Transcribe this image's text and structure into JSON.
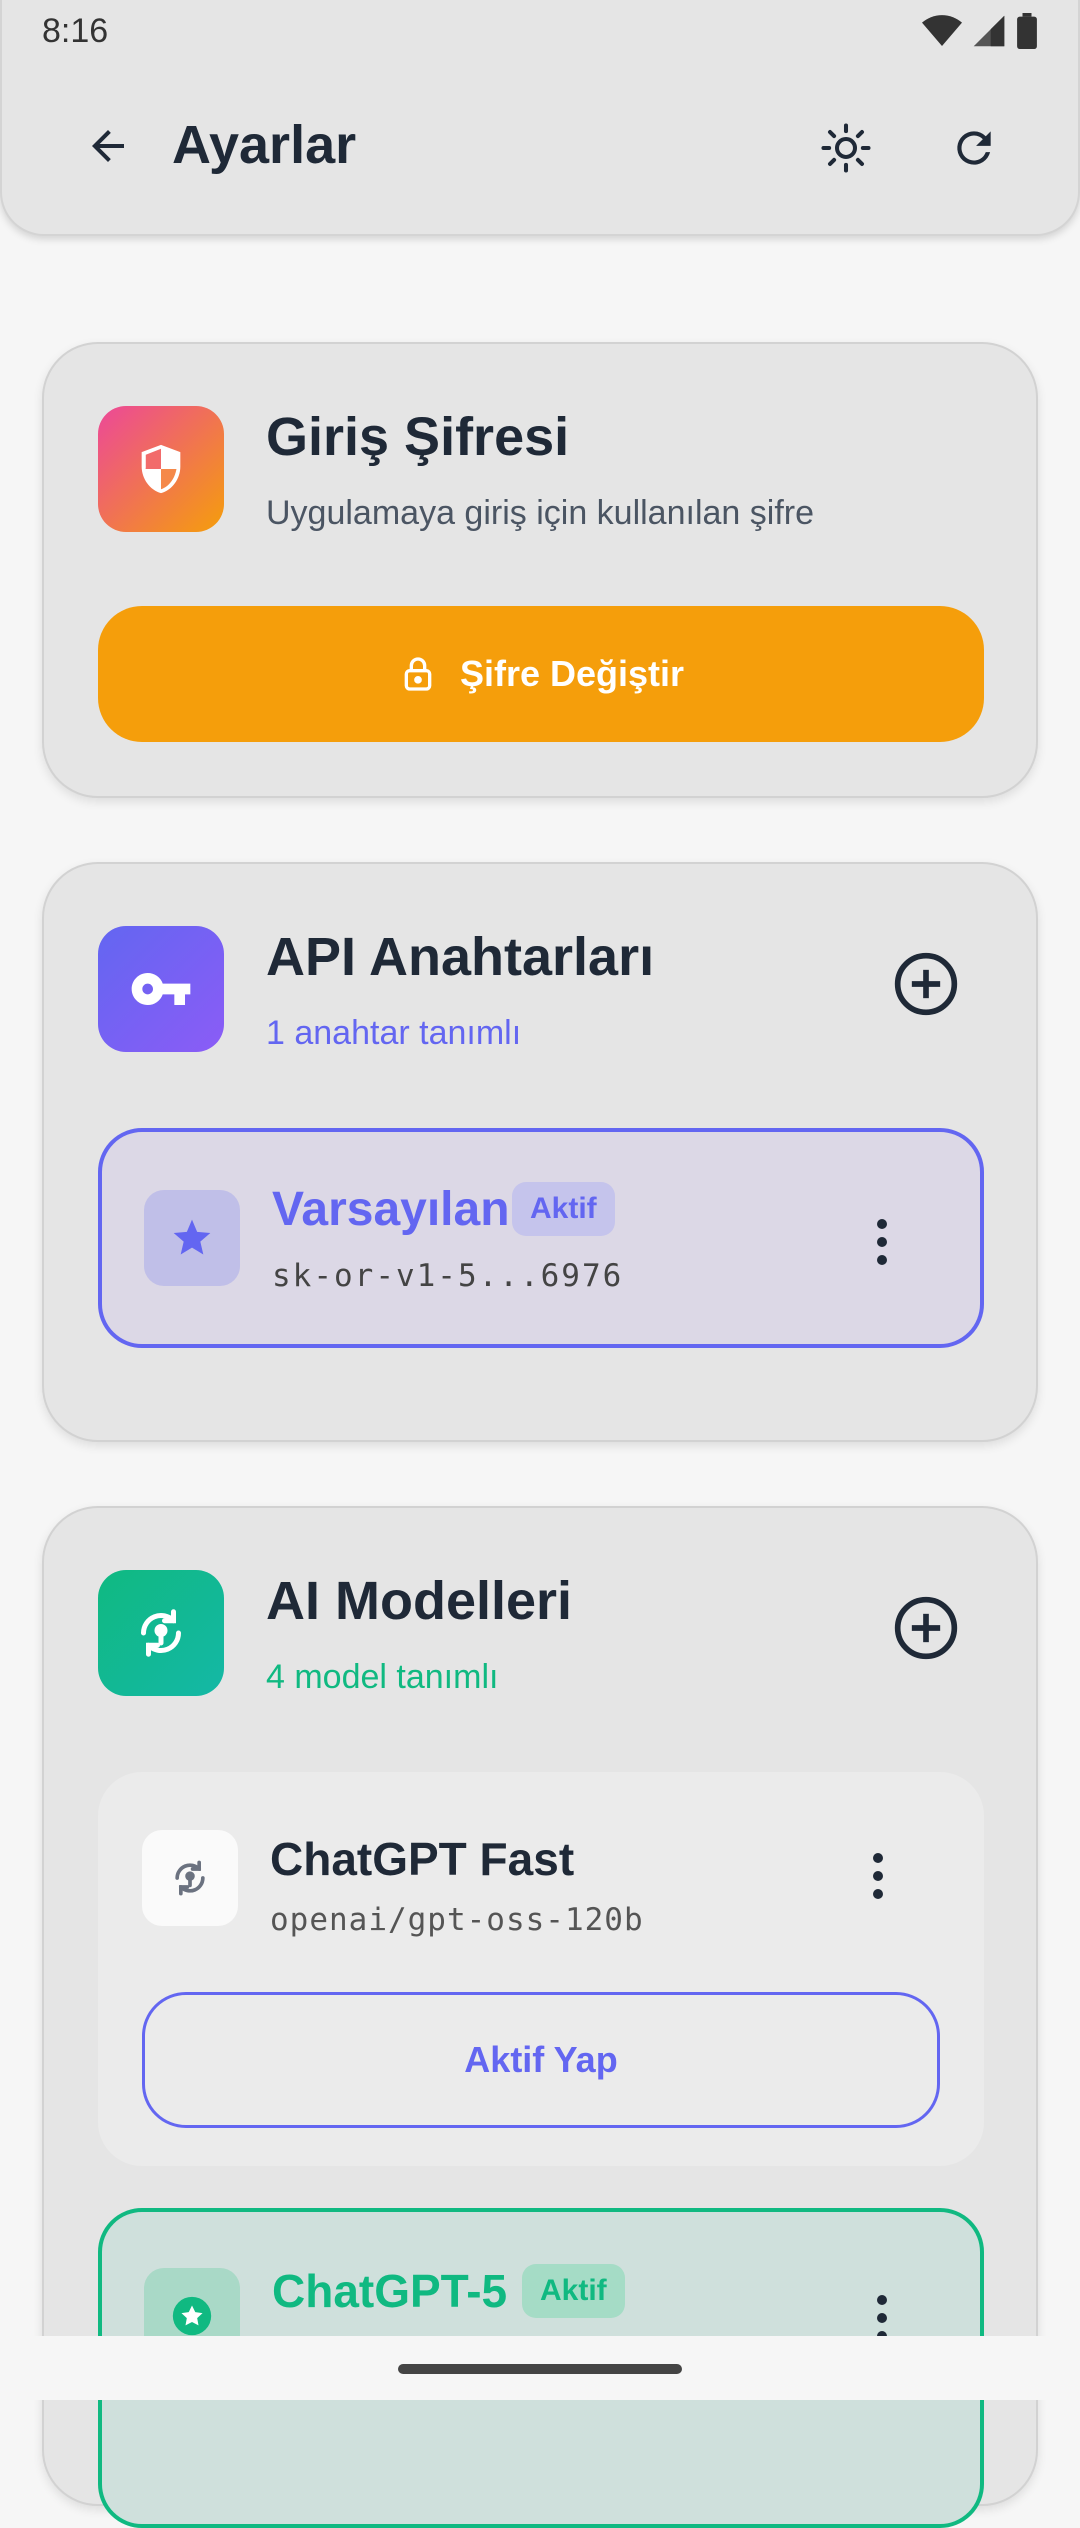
{
  "status_bar": {
    "time": "8:16"
  },
  "appbar": {
    "title": "Ayarlar"
  },
  "password_card": {
    "title": "Giriş Şifresi",
    "subtitle": "Uygulamaya giriş için kullanılan şifre",
    "button_label": "Şifre Değiştir"
  },
  "api_card": {
    "title": "API Anahtarları",
    "subtitle": "1 anahtar tanımlı",
    "keys": [
      {
        "name": "Varsayılan",
        "badge": "Aktif",
        "value": "sk-or-v1-5...6976"
      }
    ]
  },
  "models_card": {
    "title": "AI Modelleri",
    "subtitle": "4 model tanımlı",
    "models": [
      {
        "name": "ChatGPT Fast",
        "id": "openai/gpt-oss-120b",
        "action_label": "Aktif Yap"
      },
      {
        "name": "ChatGPT-5",
        "badge": "Aktif"
      }
    ]
  },
  "colors": {
    "accent_indigo": "#6366f1",
    "accent_green": "#10b981",
    "accent_orange": "#f59e0b"
  }
}
